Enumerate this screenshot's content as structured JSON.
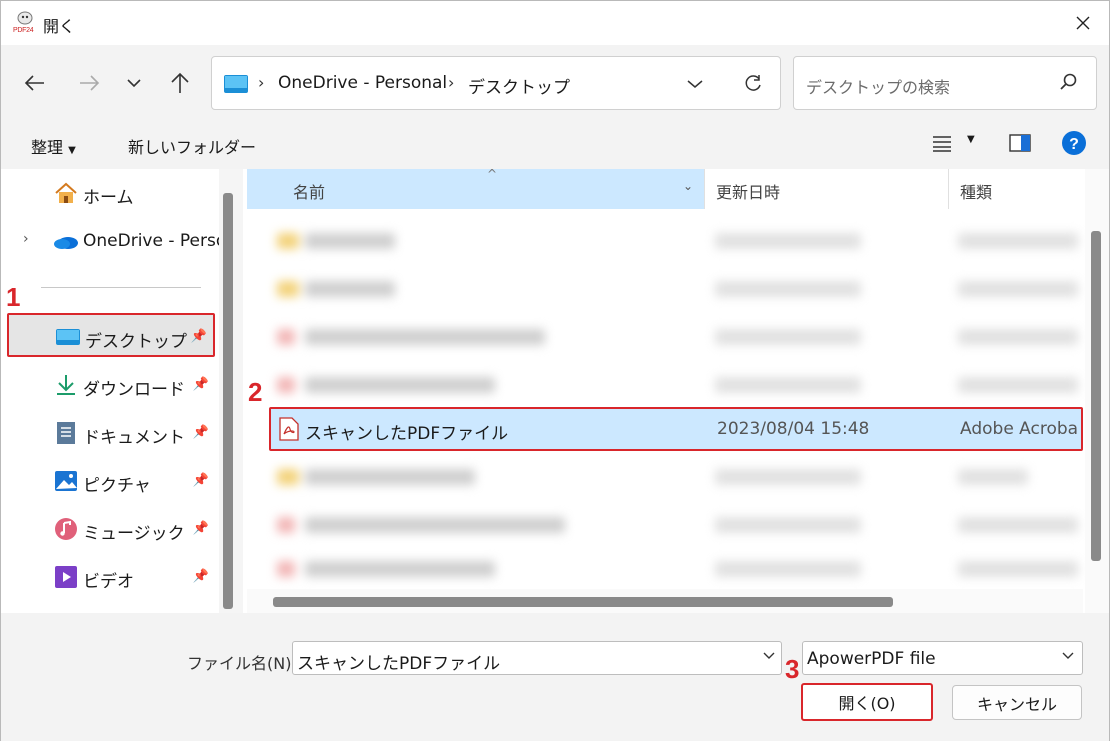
{
  "window": {
    "title": "開く",
    "app_icon_label": "PDF24"
  },
  "nav": {
    "address_segments": [
      "OneDrive - Personal",
      "デスクトップ"
    ],
    "search_placeholder": "デスクトップの検索"
  },
  "toolbar": {
    "organize_label": "整理",
    "new_folder_label": "新しいフォルダー"
  },
  "sidebar": {
    "items": [
      {
        "label": "ホーム",
        "icon": "home-icon"
      },
      {
        "label": "OneDrive - Perso",
        "icon": "onedrive-icon"
      },
      {
        "label": "デスクトップ",
        "icon": "desktop-folder-icon",
        "selected": true
      },
      {
        "label": "ダウンロード",
        "icon": "download-icon"
      },
      {
        "label": "ドキュメント",
        "icon": "document-icon"
      },
      {
        "label": "ピクチャ",
        "icon": "pictures-icon"
      },
      {
        "label": "ミュージック",
        "icon": "music-icon"
      },
      {
        "label": "ビデオ",
        "icon": "video-icon"
      }
    ]
  },
  "file_list": {
    "columns": [
      "名前",
      "更新日時",
      "種類"
    ],
    "selected_file": {
      "name": "スキャンしたPDFファイル",
      "modified": "2023/08/04 15:48",
      "type": "Adobe Acroba"
    }
  },
  "footer": {
    "filename_label": "ファイル名(N):",
    "filename_value": "スキャンしたPDFファイル",
    "filter_value": "ApowerPDF file",
    "open_label": "開く(O)",
    "cancel_label": "キャンセル"
  },
  "annotations": {
    "step1": "1",
    "step2": "2",
    "step3": "3"
  },
  "colors": {
    "highlight": "#d9262b",
    "selection": "#cce8ff",
    "accent": "#0067c0"
  }
}
